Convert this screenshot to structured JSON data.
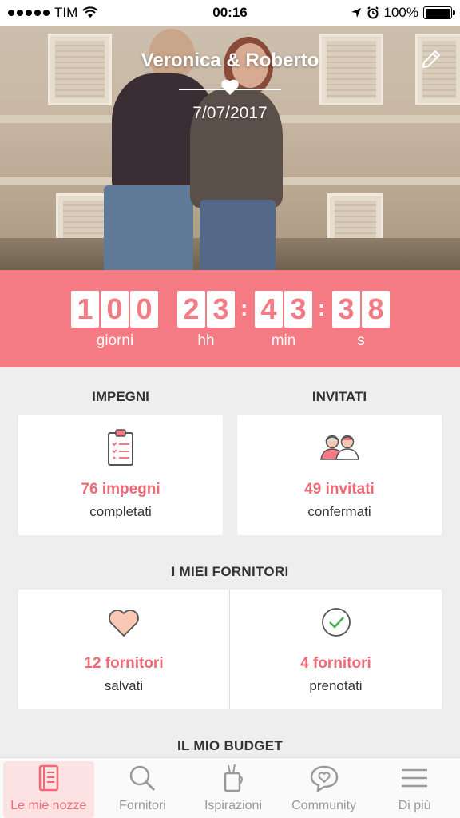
{
  "status_bar": {
    "carrier": "TIM",
    "time": "00:16",
    "battery": "100%"
  },
  "hero": {
    "couple_names": "Veronica & Roberto",
    "wedding_date": "7/07/2017"
  },
  "countdown": {
    "days": [
      "1",
      "0",
      "0"
    ],
    "hours": [
      "2",
      "3"
    ],
    "minutes": [
      "4",
      "3"
    ],
    "seconds": [
      "3",
      "8"
    ],
    "labels": {
      "days": "giorni",
      "hours": "hh",
      "minutes": "min",
      "seconds": "s"
    }
  },
  "impegni": {
    "title": "IMPEGNI",
    "value": "76 impegni",
    "sub": "completati"
  },
  "invitati": {
    "title": "INVITATI",
    "value": "49 invitati",
    "sub": "confermati"
  },
  "fornitori": {
    "title": "I MIEI FORNITORI",
    "saved": {
      "value": "12 fornitori",
      "sub": "salvati"
    },
    "booked": {
      "value": "4 fornitori",
      "sub": "prenotati"
    }
  },
  "budget": {
    "title": "IL MIO BUDGET"
  },
  "tabs": [
    {
      "label": "Le mie nozze",
      "icon": "notebook-icon"
    },
    {
      "label": "Fornitori",
      "icon": "search-icon"
    },
    {
      "label": "Ispirazioni",
      "icon": "inspiration-icon"
    },
    {
      "label": "Community",
      "icon": "community-icon"
    },
    {
      "label": "Di più",
      "icon": "menu-icon"
    }
  ],
  "colors": {
    "accent": "#f47a84",
    "accent_text": "#f06a76"
  }
}
